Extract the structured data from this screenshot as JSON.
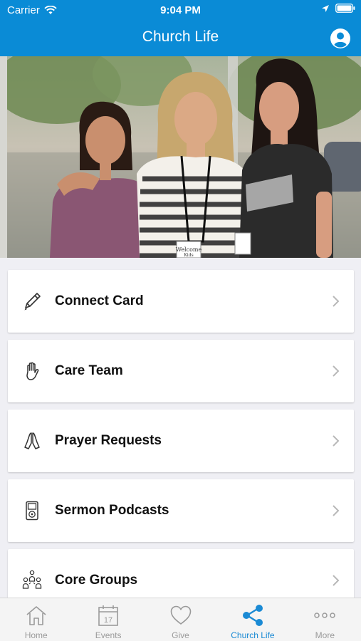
{
  "status_bar": {
    "carrier": "Carrier",
    "time": "9:04 PM"
  },
  "header": {
    "title": "Church Life"
  },
  "menu": [
    {
      "label": "Connect Card",
      "icon": "pencil-icon"
    },
    {
      "label": "Care Team",
      "icon": "hand-icon"
    },
    {
      "label": "Prayer Requests",
      "icon": "praying-hands-icon"
    },
    {
      "label": "Sermon Podcasts",
      "icon": "ipod-icon"
    },
    {
      "label": "Core Groups",
      "icon": "group-icon"
    }
  ],
  "tabs": [
    {
      "label": "Home",
      "icon": "home-icon",
      "active": false
    },
    {
      "label": "Events",
      "icon": "calendar-icon",
      "active": false
    },
    {
      "label": "Give",
      "icon": "heart-icon",
      "active": false
    },
    {
      "label": "Church Life",
      "icon": "share-icon",
      "active": true
    },
    {
      "label": "More",
      "icon": "more-icon",
      "active": false
    }
  ],
  "calendar_day": "17",
  "hero_badges": [
    "Welcome",
    "Kids"
  ],
  "colors": {
    "accent": "#0a8bd6",
    "active_tab": "#1a8ad4",
    "inactive_tab": "#9a9a9a"
  }
}
